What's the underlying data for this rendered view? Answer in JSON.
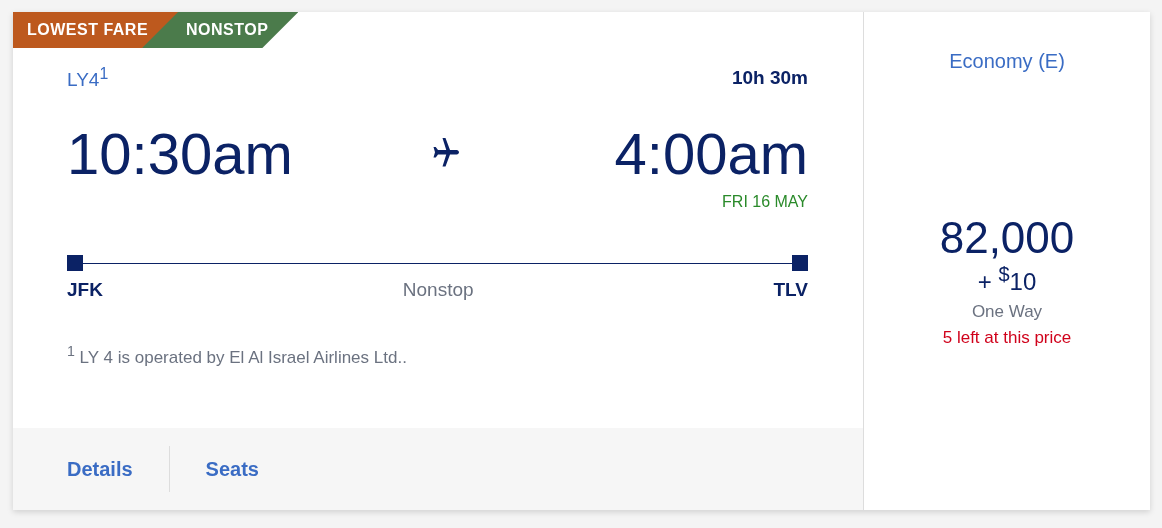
{
  "badges": [
    {
      "label": "LOWEST FARE",
      "color": "#bd591e"
    },
    {
      "label": "NONSTOP",
      "color": "#4b7b4b"
    }
  ],
  "flight": {
    "number": "LY4$^{1}$",
    "duration": "10h 30m",
    "depart_time": "10:30am",
    "arrive_time": "4:00am",
    "arrive_date": "FRI 16 MAY",
    "origin": "JFK",
    "stops": "Nonstop",
    "destination": "TLV",
    "footnote": "$^{1}$  LY 4 is operated by El Al Israel Airlines Ltd.."
  },
  "links": [
    "Details",
    "Seats"
  ],
  "fare": {
    "cabin": "Economy (E)",
    "miles": "82,000",
    "fee": "+ $^{$}$10",
    "trip": "One Way",
    "availability": "5 left at this price"
  }
}
